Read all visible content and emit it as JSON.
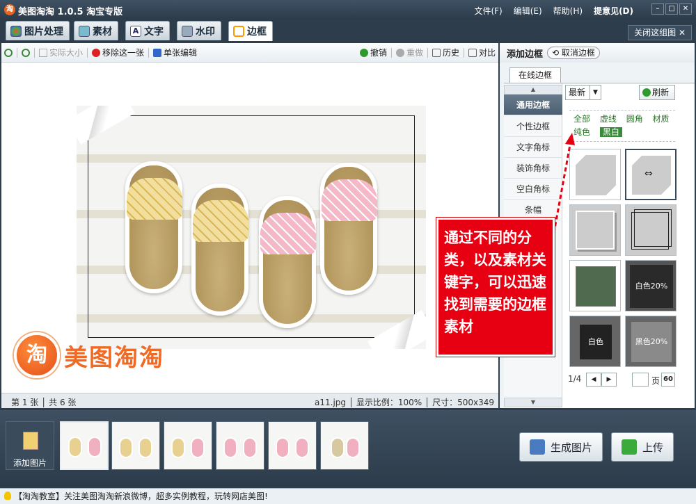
{
  "window": {
    "title": "美图淘淘 1.0.5 淘宝专版",
    "icon_char": "淘"
  },
  "menu": {
    "file": "文件(F)",
    "edit": "编辑(E)",
    "help": "帮助(H)",
    "feedback": "提意见(D)"
  },
  "tabs": [
    {
      "label": "图片处理"
    },
    {
      "label": "素材"
    },
    {
      "label": "文字"
    },
    {
      "label": "水印"
    },
    {
      "label": "边框"
    }
  ],
  "close_group": "关闭这组图",
  "toolbar": {
    "actual_size": "实际大小",
    "remove_one": "移除这一张",
    "single_edit": "单张编辑",
    "undo": "撤销",
    "redo": "重做",
    "history": "历史",
    "compare": "对比"
  },
  "watermark_text": "美图淘淘",
  "watermark_logo_char": "淘",
  "status": {
    "current": "第 1 张",
    "total": "共 6 张",
    "filename": "a11.jpg",
    "zoom": "显示比例：100%",
    "size": "尺寸：500x349"
  },
  "panel": {
    "title": "添加边框",
    "cancel": "取消边框",
    "online_tab": "在线边框",
    "sort": "最新",
    "refresh": "刷新"
  },
  "categories": [
    "通用边框",
    "个性边框",
    "文字角标",
    "装饰角标",
    "空白角标",
    "条幅"
  ],
  "filters_row1": [
    "全部",
    "虚线",
    "圆角",
    "材质"
  ],
  "filters_row2": [
    "纯色",
    "黑白"
  ],
  "thumb_labels": {
    "t7": "白色20%",
    "t9": "白色20%",
    "t10": "黑色20%"
  },
  "pagination": {
    "current": "1/4",
    "page_label": "页",
    "go": "60"
  },
  "callout": "通过不同的分类，以及素材关键字，可以迅速找到需要的边框素材",
  "filmstrip": {
    "add": "添加图片",
    "generate": "生成图片",
    "upload": "上传"
  },
  "tip": "【淘淘教室】关注美图淘淘新浪微博，超多实例教程，玩转网店美图!",
  "colors": {
    "accent_red": "#e60012",
    "brand_orange": "#f06a24",
    "active_filter": "#3a8a3a"
  }
}
